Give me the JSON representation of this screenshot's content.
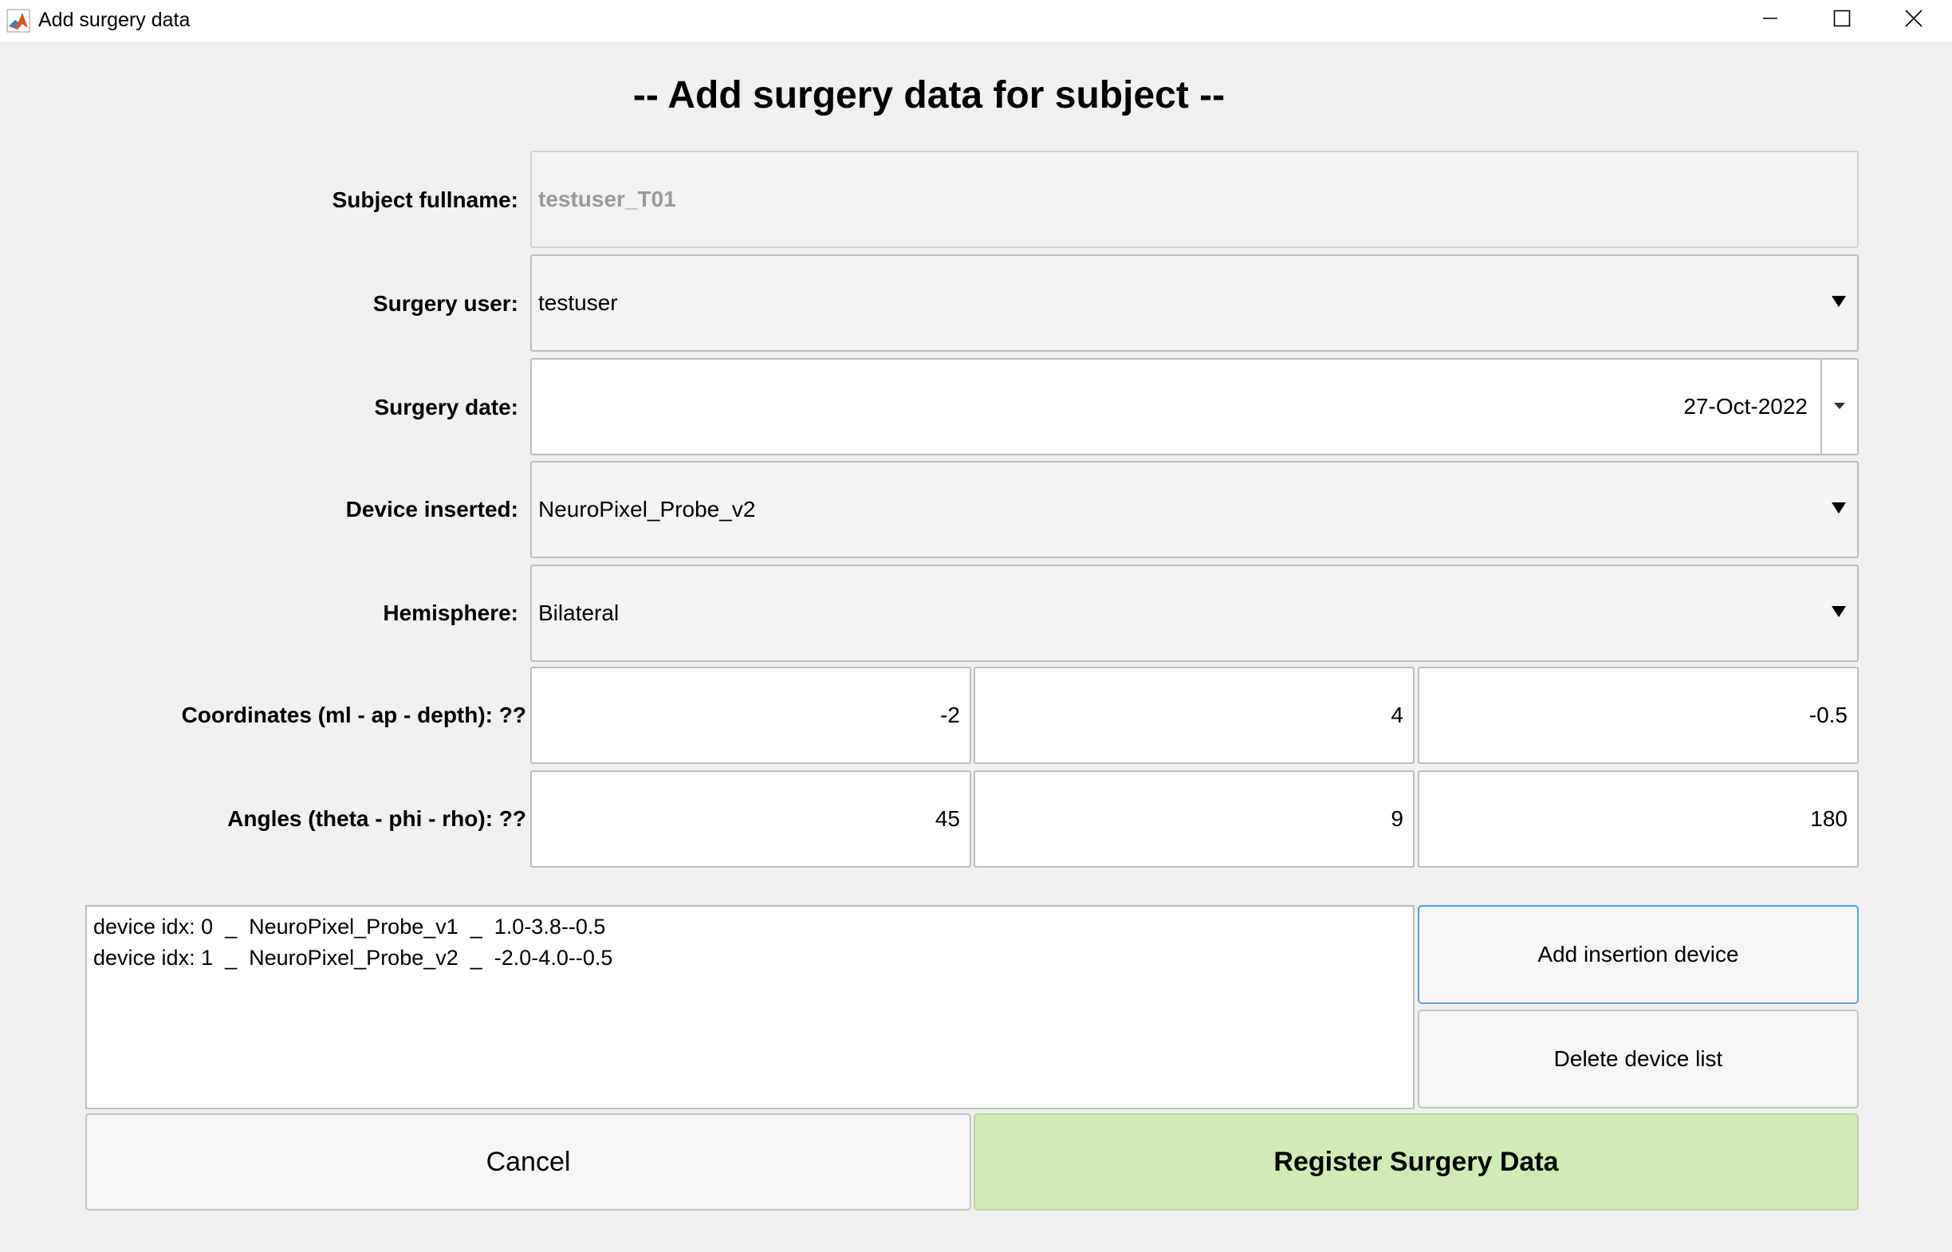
{
  "window": {
    "title": "Add surgery data",
    "icon": "matlab-icon"
  },
  "heading": "-- Add surgery data for subject --",
  "form": {
    "subject_label": "Subject fullname:",
    "subject_value": "testuser_T01",
    "user_label": "Surgery user:",
    "user_value": "testuser",
    "date_label": "Surgery date:",
    "date_value": "27-Oct-2022",
    "device_label": "Device inserted:",
    "device_value": "NeuroPixel_Probe_v2",
    "hemisphere_label": "Hemisphere:",
    "hemisphere_value": "Bilateral",
    "coords_label": "Coordinates (ml - ap - depth): ??",
    "coords": [
      "-2",
      "4",
      "-0.5"
    ],
    "angles_label": "Angles (theta - phi - rho): ??",
    "angles": [
      "45",
      "9",
      "180"
    ]
  },
  "device_list": [
    "device idx: 0  _  NeuroPixel_Probe_v1  _  1.0-3.8--0.5",
    "device idx: 1  _  NeuroPixel_Probe_v2  _  -2.0-4.0--0.5"
  ],
  "buttons": {
    "add_device": "Add insertion device",
    "delete_list": "Delete device list",
    "cancel": "Cancel",
    "register": "Register Surgery Data"
  },
  "colors": {
    "register_bg": "#d0ebb5",
    "focus_border": "#5a9ee6",
    "window_bg": "#f0f0f0"
  }
}
